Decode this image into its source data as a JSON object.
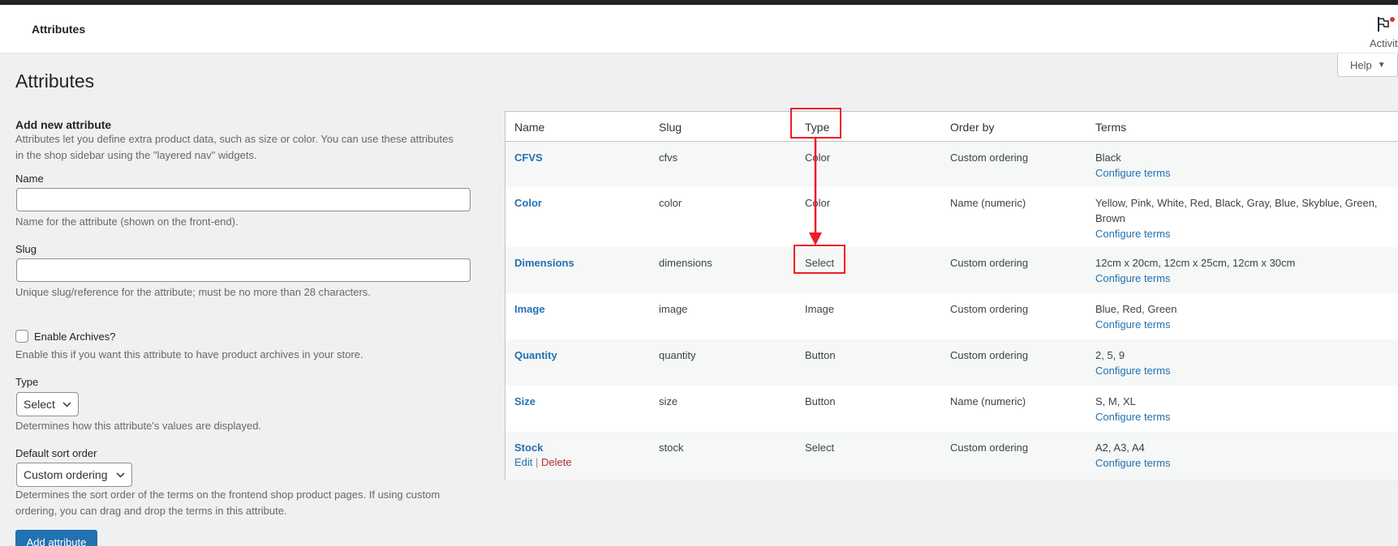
{
  "header": {
    "title": "Attributes",
    "activity_label": "Activity"
  },
  "help_tab": {
    "label": "Help"
  },
  "page_title": "Attributes",
  "form": {
    "heading": "Add new attribute",
    "intro": "Attributes let you define extra product data, such as size or color. You can use these attributes in the shop sidebar using the \"layered nav\" widgets.",
    "name_label": "Name",
    "name_value": "",
    "name_desc": "Name for the attribute (shown on the front-end).",
    "slug_label": "Slug",
    "slug_value": "",
    "slug_desc": "Unique slug/reference for the attribute; must be no more than 28 characters.",
    "archives_label": "Enable Archives?",
    "archives_desc": "Enable this if you want this attribute to have product archives in your store.",
    "type_label": "Type",
    "type_value": "Select",
    "type_desc": "Determines how this attribute's values are displayed.",
    "sort_label": "Default sort order",
    "sort_value": "Custom ordering",
    "sort_desc": "Determines the sort order of the terms on the frontend shop product pages. If using custom ordering, you can drag and drop the terms in this attribute.",
    "submit_label": "Add attribute"
  },
  "table": {
    "columns": [
      "Name",
      "Slug",
      "Type",
      "Order by",
      "Terms"
    ],
    "configure_label": "Configure terms",
    "edit_label": "Edit",
    "delete_label": "Delete",
    "separator": "|",
    "rows": [
      {
        "name": "CFVS",
        "slug": "cfvs",
        "type": "Color",
        "order_by": "Custom ordering",
        "terms": "Black"
      },
      {
        "name": "Color",
        "slug": "color",
        "type": "Color",
        "order_by": "Name (numeric)",
        "terms": "Yellow, Pink, White, Red, Black, Gray, Blue, Skyblue, Green, Brown"
      },
      {
        "name": "Dimensions",
        "slug": "dimensions",
        "type": "Select",
        "order_by": "Custom ordering",
        "terms": "12cm x 20cm, 12cm x 25cm, 12cm x 30cm"
      },
      {
        "name": "Image",
        "slug": "image",
        "type": "Image",
        "order_by": "Custom ordering",
        "terms": "Blue, Red, Green"
      },
      {
        "name": "Quantity",
        "slug": "quantity",
        "type": "Button",
        "order_by": "Custom ordering",
        "terms": "2, 5, 9"
      },
      {
        "name": "Size",
        "slug": "size",
        "type": "Button",
        "order_by": "Name (numeric)",
        "terms": "S, M, XL"
      },
      {
        "name": "Stock",
        "slug": "stock",
        "type": "Select",
        "order_by": "Custom ordering",
        "terms": "A2, A3, A4"
      }
    ]
  },
  "colors": {
    "accent": "#2271b1",
    "danger": "#b32d2e",
    "annotation": "#ee1c25"
  },
  "icons": {
    "activity": "flag-icon",
    "dropdown": "chevron-down-icon"
  }
}
